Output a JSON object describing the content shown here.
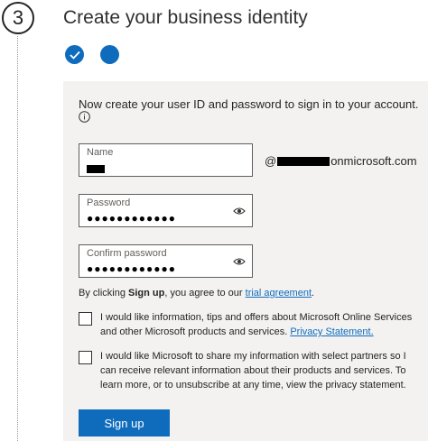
{
  "step": {
    "number": "3"
  },
  "header": {
    "title": "Create your business identity"
  },
  "form": {
    "intro": "Now create your user ID and password to sign in to your account.",
    "name": {
      "label": "Name"
    },
    "domain": {
      "prefix": "@",
      "suffix": "onmicrosoft.com"
    },
    "password": {
      "label": "Password",
      "value": "●●●●●●●●●●●●"
    },
    "confirm": {
      "label": "Confirm password",
      "value": "●●●●●●●●●●●●"
    },
    "agreement": {
      "before": "By clicking ",
      "bold": "Sign up",
      "middle": ", you agree to our ",
      "link": "trial agreement",
      "after": "."
    },
    "checkbox1": {
      "text": "I would like information, tips and offers about Microsoft Online Services and other Microsoft products and services. ",
      "link": "Privacy Statement."
    },
    "checkbox2": {
      "text": "I would like Microsoft to share my information with select partners so I can receive relevant information about their products and services. To learn more, or to unsubscribe at any time, view the privacy statement."
    },
    "signup_label": "Sign up"
  },
  "colors": {
    "accent": "#0f6cbd",
    "panel": "#f3f2f1"
  }
}
